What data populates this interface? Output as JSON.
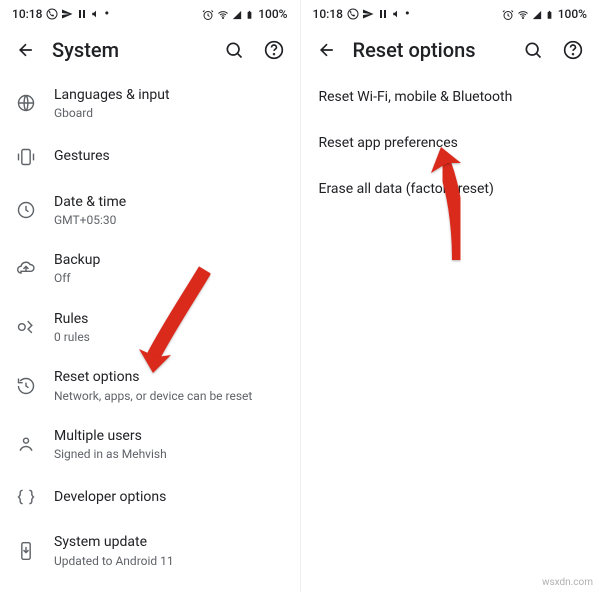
{
  "status": {
    "time": "10:18",
    "battery": "100%"
  },
  "left": {
    "title": "System",
    "items": [
      {
        "icon": "globe",
        "title": "Languages & input",
        "sub": "Gboard"
      },
      {
        "icon": "phone-vibrate",
        "title": "Gestures",
        "sub": ""
      },
      {
        "icon": "clock",
        "title": "Date & time",
        "sub": "GMT+05:30"
      },
      {
        "icon": "cloud-up",
        "title": "Backup",
        "sub": "Off"
      },
      {
        "icon": "rules",
        "title": "Rules",
        "sub": "0 rules"
      },
      {
        "icon": "reset",
        "title": "Reset options",
        "sub": "Network, apps, or device can be reset"
      },
      {
        "icon": "users",
        "title": "Multiple users",
        "sub": "Signed in as Mehvish"
      },
      {
        "icon": "braces",
        "title": "Developer options",
        "sub": ""
      },
      {
        "icon": "system-update",
        "title": "System update",
        "sub": "Updated to Android 11"
      }
    ]
  },
  "right": {
    "title": "Reset options",
    "items": [
      {
        "title": "Reset Wi-Fi, mobile & Bluetooth"
      },
      {
        "title": "Reset app preferences"
      },
      {
        "title": "Erase all data (factory reset)"
      }
    ]
  },
  "watermark": "wsxdn.com"
}
